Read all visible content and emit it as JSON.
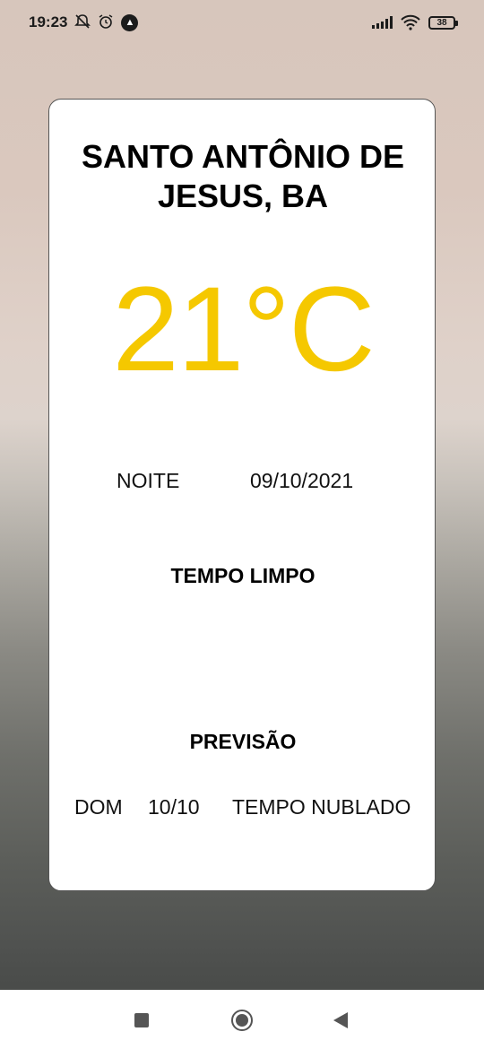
{
  "status_bar": {
    "time": "19:23",
    "icons": [
      "notifications-off-icon",
      "alarm-icon",
      "app-notification-icon",
      "signal-icon",
      "wifi-icon",
      "battery-icon"
    ],
    "battery_level": "38"
  },
  "weather": {
    "city": "SANTO ANTÔNIO DE JESUS, BA",
    "temperature": "21°C",
    "period": "NOITE",
    "date": "09/10/2021",
    "condition": "TEMPO LIMPO"
  },
  "forecast": {
    "title": "PREVISÃO",
    "items": [
      {
        "day": "DOM",
        "date": "10/10",
        "condition": "TEMPO NUBLADO"
      }
    ]
  },
  "colors": {
    "temperature": "#f5c800",
    "card_background": "#ffffff"
  },
  "nav_bar": {
    "buttons": [
      "recents-icon",
      "home-icon",
      "back-icon"
    ]
  }
}
